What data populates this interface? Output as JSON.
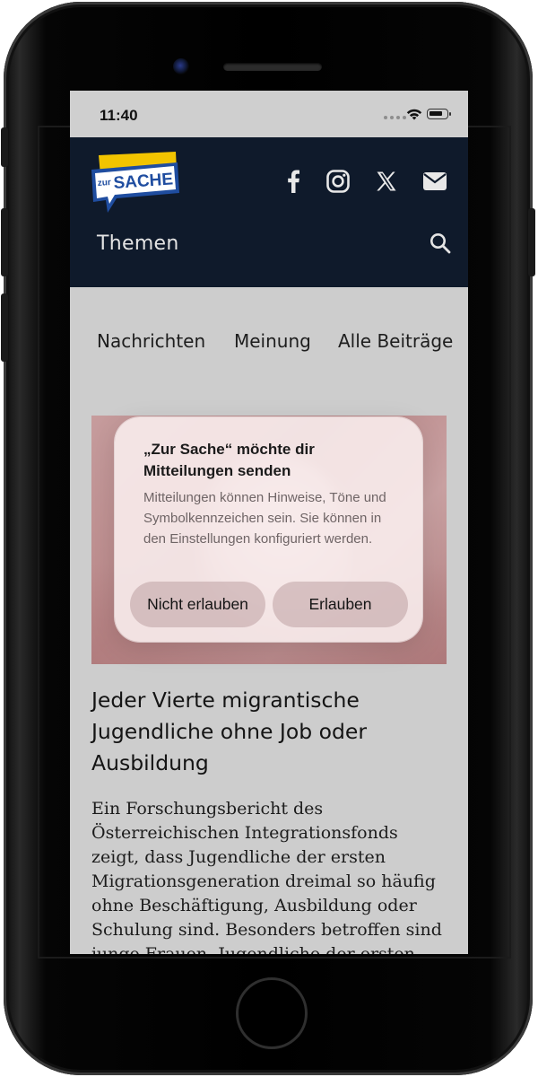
{
  "status_bar": {
    "time": "11:40"
  },
  "header": {
    "logo": {
      "small": "zur",
      "big": "SACHE"
    },
    "social_icons": [
      "facebook-icon",
      "instagram-icon",
      "x-icon",
      "mail-icon"
    ],
    "menu_label": "Themen"
  },
  "nav_tabs": [
    "Nachrichten",
    "Meinung",
    "Alle Beiträge"
  ],
  "notification_dialog": {
    "title": "„Zur Sache“ möchte dir Mitteilungen senden",
    "body": "Mitteilungen können Hinweise, Töne und Symbolkennzeichen sein. Sie können in den Einstellungen konfigu­riert werden.",
    "deny_label": "Nicht erlauben",
    "allow_label": "Erlauben"
  },
  "article": {
    "headline": "Jeder Vierte migrantische Jugendliche ohne Job oder Ausbildung",
    "text": "Ein Forschungsbericht des Österreichischen Integrationsfonds zeigt, dass Jugendliche der ersten Migrationsgeneration dreimal so häufig ohne Beschäftigung, Ausbildung oder Schulung sind. Besonders betroffen sind junge Frauen. Jugendliche der ersten"
  },
  "colors": {
    "header_bg": "#0f1a2b",
    "logo_yellow": "#f2c400",
    "logo_blue": "#1f4da0",
    "page_bg": "#cdcdcd"
  }
}
